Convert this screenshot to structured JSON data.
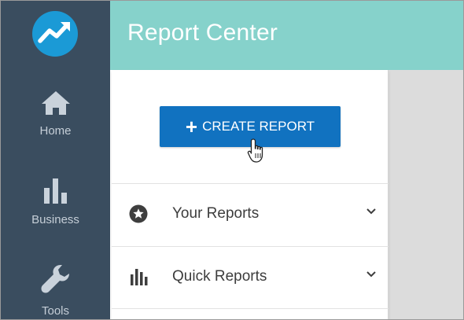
{
  "header": {
    "title": "Report Center"
  },
  "sidebar": {
    "logo_icon": "trending-up-logo-icon",
    "items": [
      {
        "label": "Home",
        "icon": "home-icon"
      },
      {
        "label": "Business",
        "icon": "bar-chart-icon"
      },
      {
        "label": "Tools",
        "icon": "wrench-icon"
      }
    ]
  },
  "main": {
    "create_button": {
      "plus": "+",
      "label": "CREATE REPORT"
    },
    "sections": [
      {
        "label": "Your Reports",
        "icon": "star-circle-icon"
      },
      {
        "label": "Quick Reports",
        "icon": "bar-chart-icon"
      }
    ]
  },
  "colors": {
    "sidebar": "#3a4d5f",
    "header": "#86d2cb",
    "button": "#1172c0",
    "logo": "#1b9ad6"
  }
}
